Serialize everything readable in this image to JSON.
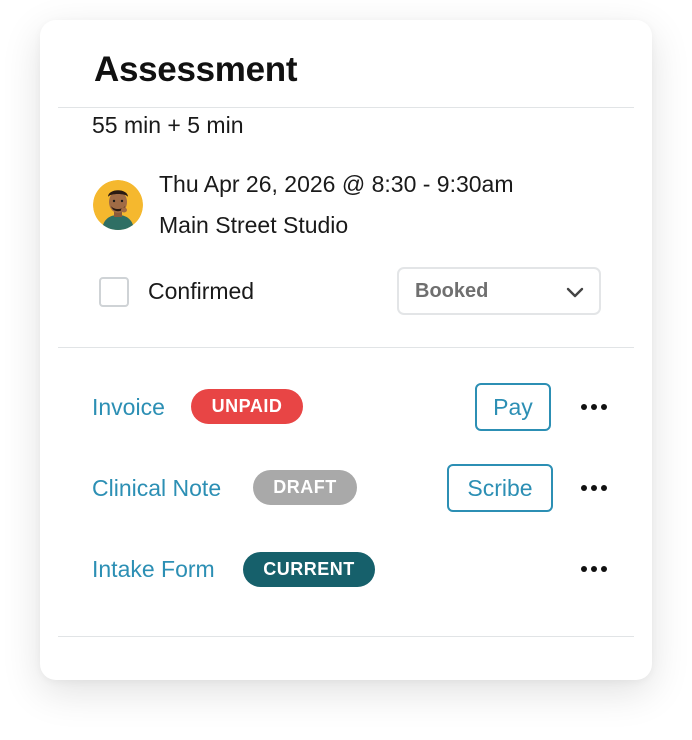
{
  "card": {
    "title": "Assessment",
    "duration": "55 min + 5 min",
    "appointment": {
      "datetime": "Thu Apr 26, 2026 @ 8:30 - 9:30am",
      "location": "Main Street Studio"
    },
    "confirmed": {
      "label": "Confirmed",
      "checked": false
    },
    "status_select": {
      "value": "Booked"
    }
  },
  "documents": [
    {
      "label": "Invoice",
      "badge": "UNPAID",
      "badge_color": "#e84545",
      "action": "Pay"
    },
    {
      "label": "Clinical Note",
      "badge": "DRAFT",
      "badge_color": "#a9a9a9",
      "action": "Scribe"
    },
    {
      "label": "Intake Form",
      "badge": "CURRENT",
      "badge_color": "#16606b",
      "action": ""
    }
  ],
  "colors": {
    "link": "#2c8fb4",
    "divider": "#e1e4e6",
    "avatar_bg": "#f5b82e"
  },
  "icons": {
    "avatar": "person-avatar",
    "select": "chevron-down-icon",
    "more": "more-horizontal-icon"
  }
}
